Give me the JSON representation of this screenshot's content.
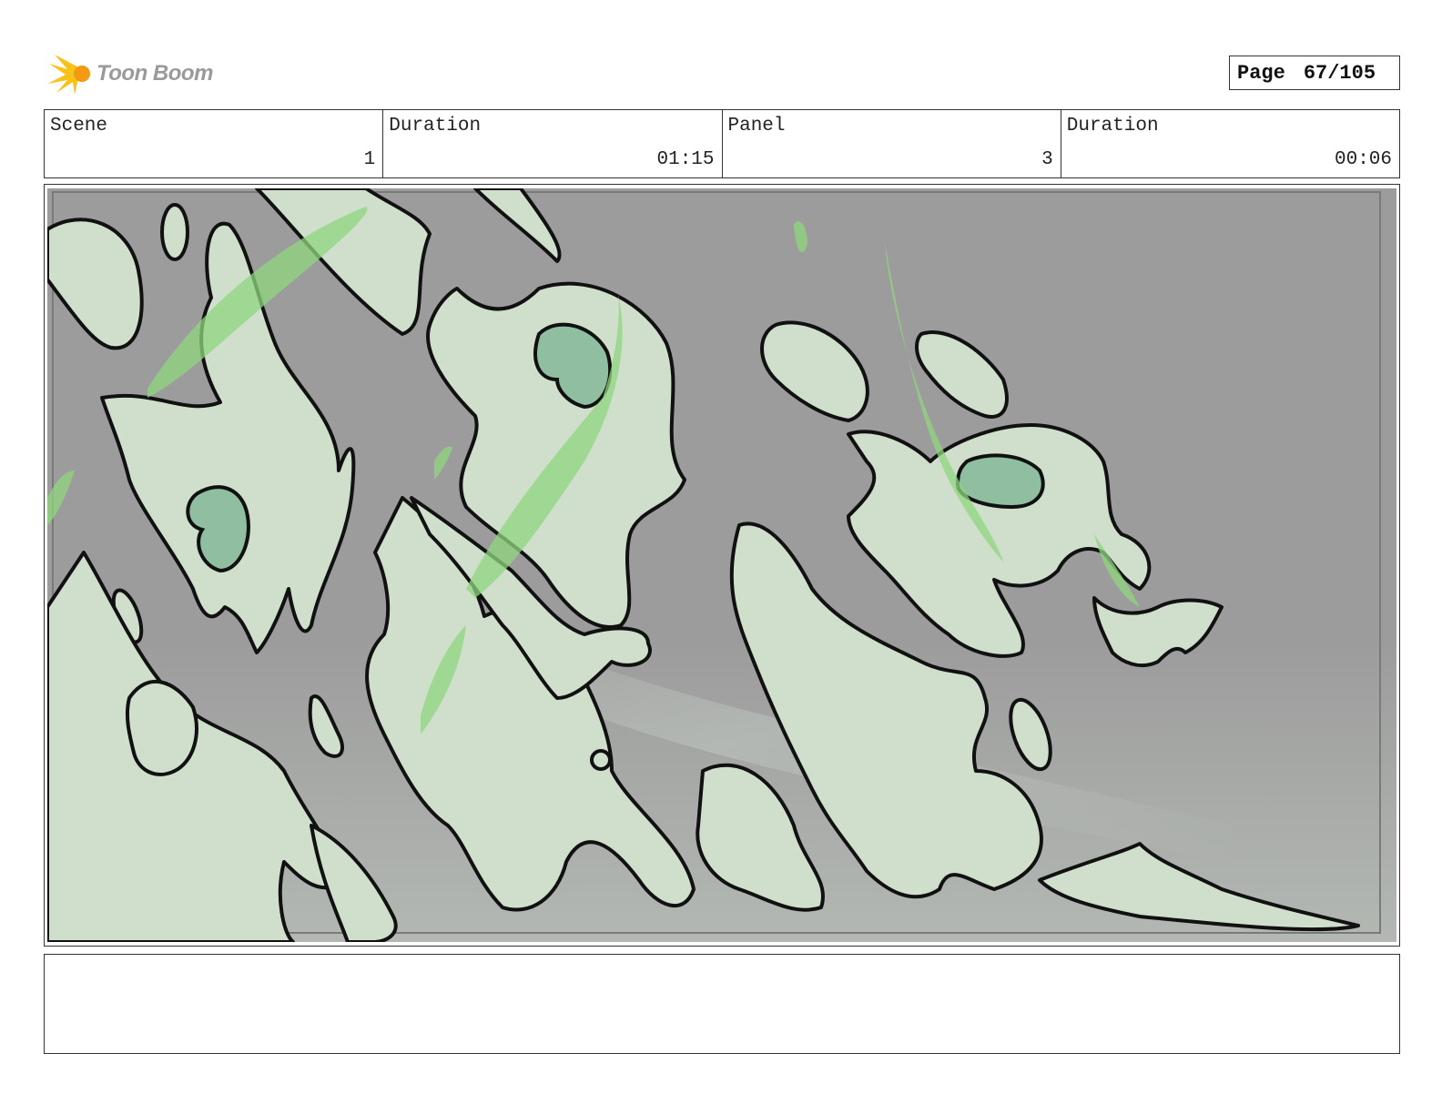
{
  "header": {
    "logo_text": "Toon Boom",
    "page_label": "Page",
    "page_value": "67/105"
  },
  "info": {
    "scene_label": "Scene",
    "scene_value": "1",
    "scene_duration_label": "Duration",
    "scene_duration_value": "01:15",
    "panel_label": "Panel",
    "panel_value": "3",
    "panel_duration_label": "Duration",
    "panel_duration_value": "00:06"
  },
  "notes": {
    "text": ""
  }
}
